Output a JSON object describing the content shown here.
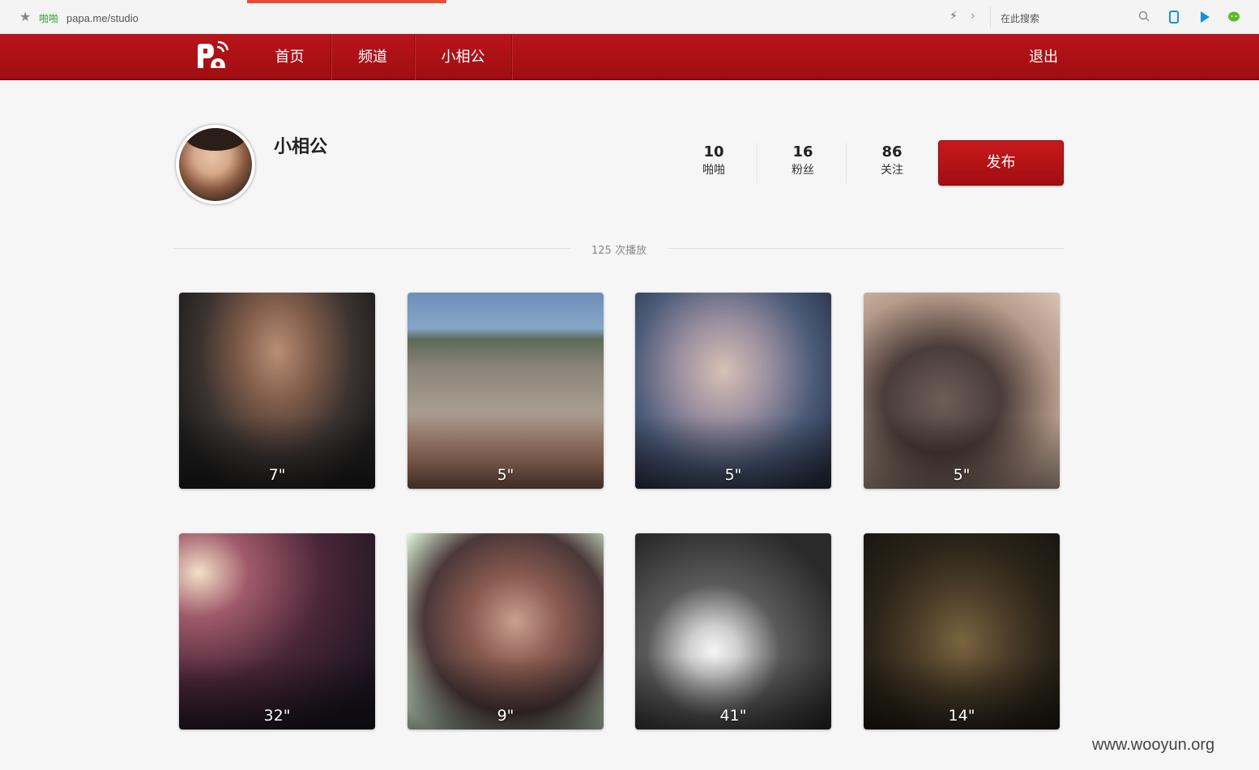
{
  "browser": {
    "site_name": "啪啪",
    "url": "papa.me/studio",
    "search_placeholder": "在此搜索"
  },
  "nav": {
    "items": [
      {
        "label": "首页"
      },
      {
        "label": "频道"
      },
      {
        "label": "小相公"
      }
    ],
    "logout_label": "退出"
  },
  "profile": {
    "username": "小相公",
    "stats": [
      {
        "value": "10",
        "label": "啪啪"
      },
      {
        "value": "16",
        "label": "粉丝"
      },
      {
        "value": "86",
        "label": "关注"
      }
    ],
    "publish_label": "发布",
    "plays_text": "125  次播放"
  },
  "videos": [
    {
      "duration": "7\""
    },
    {
      "duration": "5\""
    },
    {
      "duration": "5\""
    },
    {
      "duration": "5\""
    },
    {
      "duration": "32\""
    },
    {
      "duration": "9\""
    },
    {
      "duration": "41\""
    },
    {
      "duration": "14\""
    }
  ],
  "watermark": "www.wooyun.org",
  "colors": {
    "nav_red": "#b8141a",
    "publish_red": "#c8191d",
    "tab_indicator": "#e94b35"
  }
}
